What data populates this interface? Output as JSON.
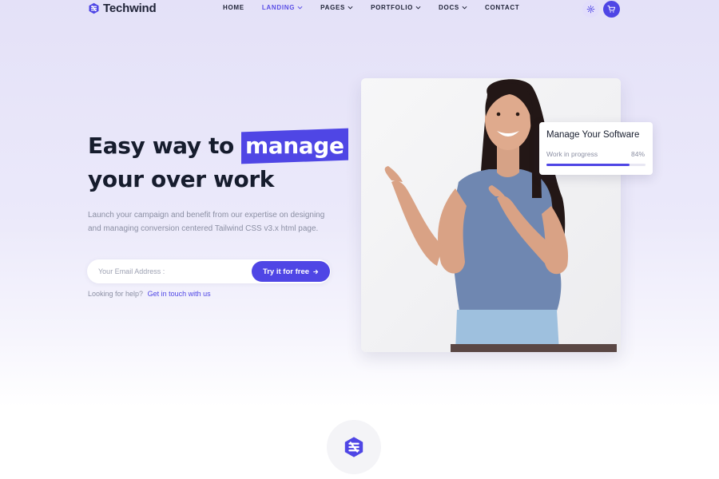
{
  "brand": {
    "name": "Techwind",
    "accent": "#4f46e5"
  },
  "nav": {
    "items": [
      {
        "label": "HOME",
        "dropdown": false,
        "active": false
      },
      {
        "label": "LANDING",
        "dropdown": true,
        "active": true
      },
      {
        "label": "PAGES",
        "dropdown": true,
        "active": false
      },
      {
        "label": "PORTFOLIO",
        "dropdown": true,
        "active": false
      },
      {
        "label": "DOCS",
        "dropdown": true,
        "active": false
      },
      {
        "label": "CONTACT",
        "dropdown": false,
        "active": false
      }
    ],
    "icons": [
      "settings-icon",
      "cart-icon"
    ]
  },
  "hero": {
    "title_before": "Easy way to",
    "title_highlight": "manage",
    "title_after": "your over work",
    "description": "Launch your campaign and benefit from our expertise on designing and managing conversion centered Tailwind CSS v3.x html page.",
    "email_placeholder": "Your Email Address :",
    "cta_label": "Try it for free",
    "help_text": "Looking for help?",
    "help_link": "Get in touch with us"
  },
  "progress_card": {
    "title": "Manage Your Software",
    "label": "Work in progress",
    "percent_text": "84%",
    "percent": 84
  }
}
